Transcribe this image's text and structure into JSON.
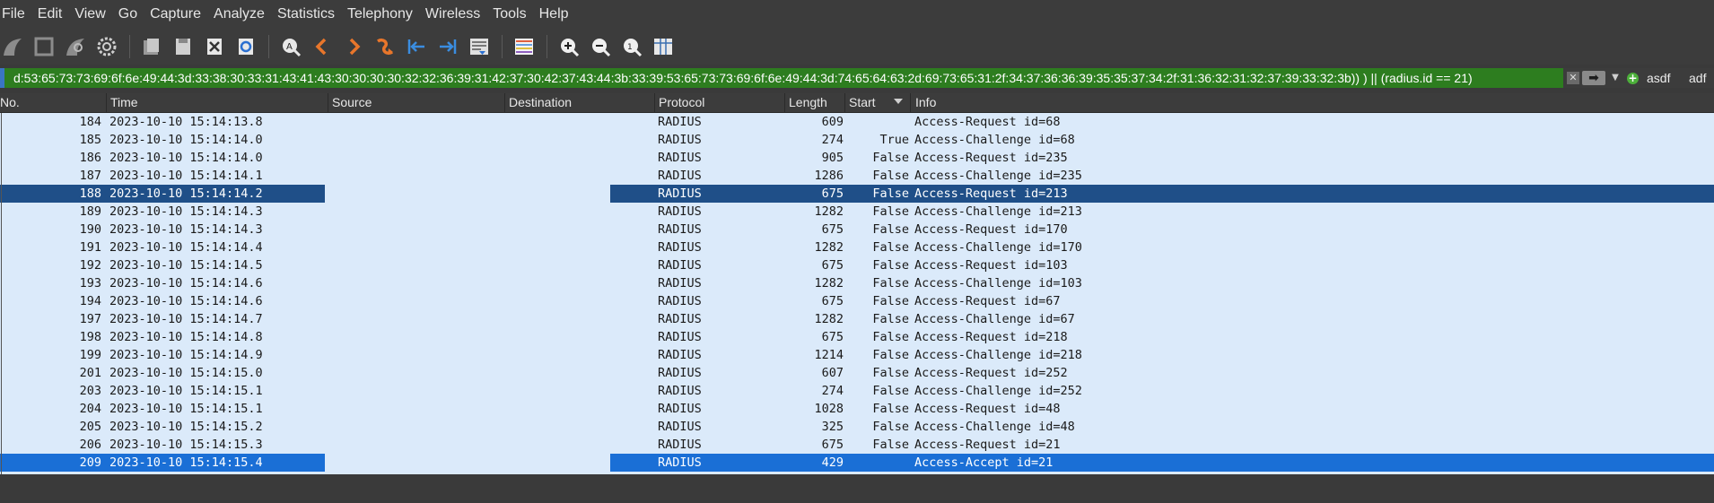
{
  "menu": [
    "File",
    "Edit",
    "View",
    "Go",
    "Capture",
    "Analyze",
    "Statistics",
    "Telephony",
    "Wireless",
    "Tools",
    "Help"
  ],
  "toolbar_icons": [
    "shark-fin-start-icon",
    "stop-capture-icon",
    "restart-capture-icon",
    "capture-options-icon",
    "open-file-icon",
    "save-file-icon",
    "close-file-icon",
    "reload-file-icon",
    "find-packet-icon",
    "go-back-icon",
    "go-forward-icon",
    "go-to-packet-icon",
    "go-first-packet-icon",
    "go-last-packet-icon",
    "autoscroll-icon",
    "colorize-icon",
    "zoom-in-icon",
    "zoom-out-icon",
    "normal-size-icon",
    "resize-columns-icon"
  ],
  "filter": {
    "value": "d:53:65:73:73:69:6f:6e:49:44:3d:33:38:30:33:31:43:41:43:30:30:30:30:32:32:36:39:31:42:37:30:42:37:43:44:3b:33:39:53:65:73:73:69:6f:6e:49:44:3d:74:65:64:63:2d:69:73:65:31:2f:34:37:36:36:39:35:35:37:34:2f:31:36:32:31:32:37:39:33:32:3b)) ) || (radius.id == 21)",
    "buttons": [
      "asdf",
      "adf"
    ],
    "valid_color": "#2d7d1f"
  },
  "columns": {
    "no": "No.",
    "time": "Time",
    "source": "Source",
    "destination": "Destination",
    "protocol": "Protocol",
    "length": "Length",
    "start": "Start",
    "info": "Info"
  },
  "packets": [
    {
      "no": "184",
      "time": "2023-10-10 15:14:13.8",
      "proto": "RADIUS",
      "len": "609",
      "start": "",
      "info": "Access-Request id=68"
    },
    {
      "no": "185",
      "time": "2023-10-10 15:14:14.0",
      "proto": "RADIUS",
      "len": "274",
      "start": "True",
      "info": "Access-Challenge id=68"
    },
    {
      "no": "186",
      "time": "2023-10-10 15:14:14.0",
      "proto": "RADIUS",
      "len": "905",
      "start": "False",
      "info": "Access-Request id=235"
    },
    {
      "no": "187",
      "time": "2023-10-10 15:14:14.1",
      "proto": "RADIUS",
      "len": "1286",
      "start": "False",
      "info": "Access-Challenge id=235"
    },
    {
      "no": "188",
      "time": "2023-10-10 15:14:14.2",
      "proto": "RADIUS",
      "len": "675",
      "start": "False",
      "info": "Access-Request id=213"
    },
    {
      "no": "189",
      "time": "2023-10-10 15:14:14.3",
      "proto": "RADIUS",
      "len": "1282",
      "start": "False",
      "info": "Access-Challenge id=213"
    },
    {
      "no": "190",
      "time": "2023-10-10 15:14:14.3",
      "proto": "RADIUS",
      "len": "675",
      "start": "False",
      "info": "Access-Request id=170"
    },
    {
      "no": "191",
      "time": "2023-10-10 15:14:14.4",
      "proto": "RADIUS",
      "len": "1282",
      "start": "False",
      "info": "Access-Challenge id=170"
    },
    {
      "no": "192",
      "time": "2023-10-10 15:14:14.5",
      "proto": "RADIUS",
      "len": "675",
      "start": "False",
      "info": "Access-Request id=103"
    },
    {
      "no": "193",
      "time": "2023-10-10 15:14:14.6",
      "proto": "RADIUS",
      "len": "1282",
      "start": "False",
      "info": "Access-Challenge id=103"
    },
    {
      "no": "194",
      "time": "2023-10-10 15:14:14.6",
      "proto": "RADIUS",
      "len": "675",
      "start": "False",
      "info": "Access-Request id=67"
    },
    {
      "no": "197",
      "time": "2023-10-10 15:14:14.7",
      "proto": "RADIUS",
      "len": "1282",
      "start": "False",
      "info": "Access-Challenge id=67"
    },
    {
      "no": "198",
      "time": "2023-10-10 15:14:14.8",
      "proto": "RADIUS",
      "len": "675",
      "start": "False",
      "info": "Access-Request id=218"
    },
    {
      "no": "199",
      "time": "2023-10-10 15:14:14.9",
      "proto": "RADIUS",
      "len": "1214",
      "start": "False",
      "info": "Access-Challenge id=218"
    },
    {
      "no": "201",
      "time": "2023-10-10 15:14:15.0",
      "proto": "RADIUS",
      "len": "607",
      "start": "False",
      "info": "Access-Request id=252"
    },
    {
      "no": "203",
      "time": "2023-10-10 15:14:15.1",
      "proto": "RADIUS",
      "len": "274",
      "start": "False",
      "info": "Access-Challenge id=252"
    },
    {
      "no": "204",
      "time": "2023-10-10 15:14:15.1",
      "proto": "RADIUS",
      "len": "1028",
      "start": "False",
      "info": "Access-Request id=48"
    },
    {
      "no": "205",
      "time": "2023-10-10 15:14:15.2",
      "proto": "RADIUS",
      "len": "325",
      "start": "False",
      "info": "Access-Challenge id=48"
    },
    {
      "no": "206",
      "time": "2023-10-10 15:14:15.3",
      "proto": "RADIUS",
      "len": "675",
      "start": "False",
      "info": "Access-Request id=21"
    },
    {
      "no": "209",
      "time": "2023-10-10 15:14:15.4",
      "proto": "RADIUS",
      "len": "429",
      "start": "",
      "info": "Access-Accept id=21"
    }
  ],
  "selection": {
    "primary_packet": "209",
    "secondary_packet": "188"
  },
  "colors": {
    "row_bg": "#dbeafa",
    "selected_active": "#1a6fd6",
    "selected_inactive": "#1f4f88",
    "menubar_bg": "#3c3c3c"
  }
}
